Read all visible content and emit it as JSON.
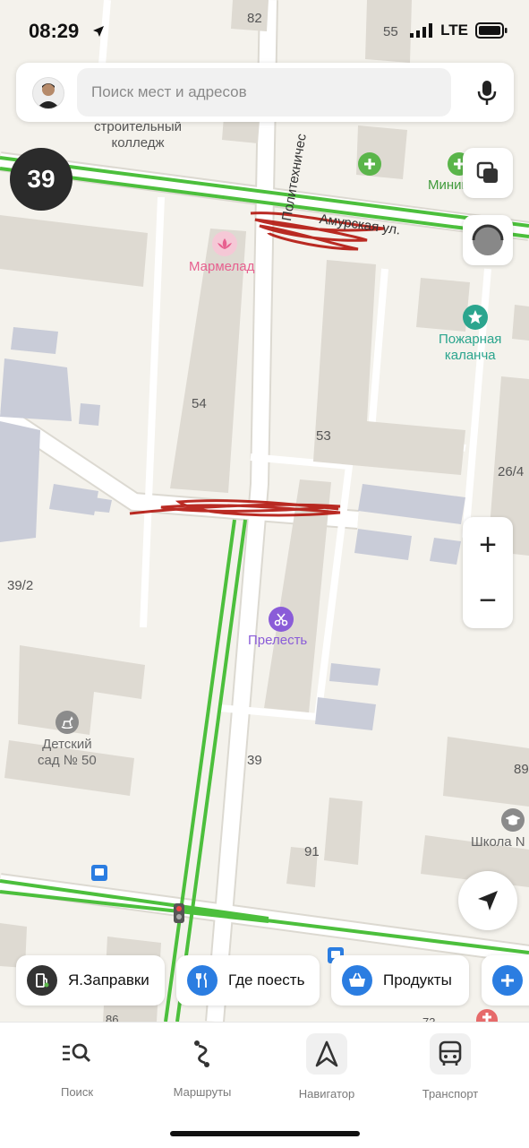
{
  "status_bar": {
    "time": "08:29",
    "network": "LTE"
  },
  "search": {
    "placeholder": "Поиск мест и адресов"
  },
  "route_badge": "39",
  "map": {
    "street_amurskaya": "Амурская ул.",
    "street_polytech": "Политехничес",
    "building_labels": {
      "b82": "82",
      "b55": "55",
      "b54": "54",
      "b53": "53",
      "b26_4": "26/4",
      "b39_2": "39/2",
      "b39": "39",
      "b91": "91",
      "b89": "89",
      "b86": "86",
      "b73": "73"
    },
    "pois": {
      "college": "строительный\nколледж",
      "marmelad": "Мармелад",
      "minice": "Миниц",
      "fire_tower": "Пожарная\nкаланча",
      "prelest": "Прелесть",
      "kindergarten": "Детский\nсад № 50",
      "school": "Школа N"
    },
    "colors": {
      "route_green": "#4cbf3c",
      "poi_pink": "#e7608f",
      "poi_teal": "#2ba58e",
      "poi_purple": "#8a5cd8",
      "poi_gray": "#8b8b8b",
      "scribble_red": "#b3140c"
    }
  },
  "controls": {
    "zoom_in": "+",
    "zoom_out": "−"
  },
  "chips": [
    {
      "label": "Я.Заправки",
      "icon": "fuel-icon"
    },
    {
      "label": "Где поесть",
      "icon": "fork-knife-icon"
    },
    {
      "label": "Продукты",
      "icon": "basket-icon"
    },
    {
      "label": "",
      "icon": "plus-icon"
    }
  ],
  "tabs": [
    {
      "label": "Поиск",
      "icon": "search-list-icon"
    },
    {
      "label": "Маршруты",
      "icon": "routes-icon"
    },
    {
      "label": "Навигатор",
      "icon": "navigator-icon"
    },
    {
      "label": "Транспорт",
      "icon": "bus-icon"
    }
  ]
}
